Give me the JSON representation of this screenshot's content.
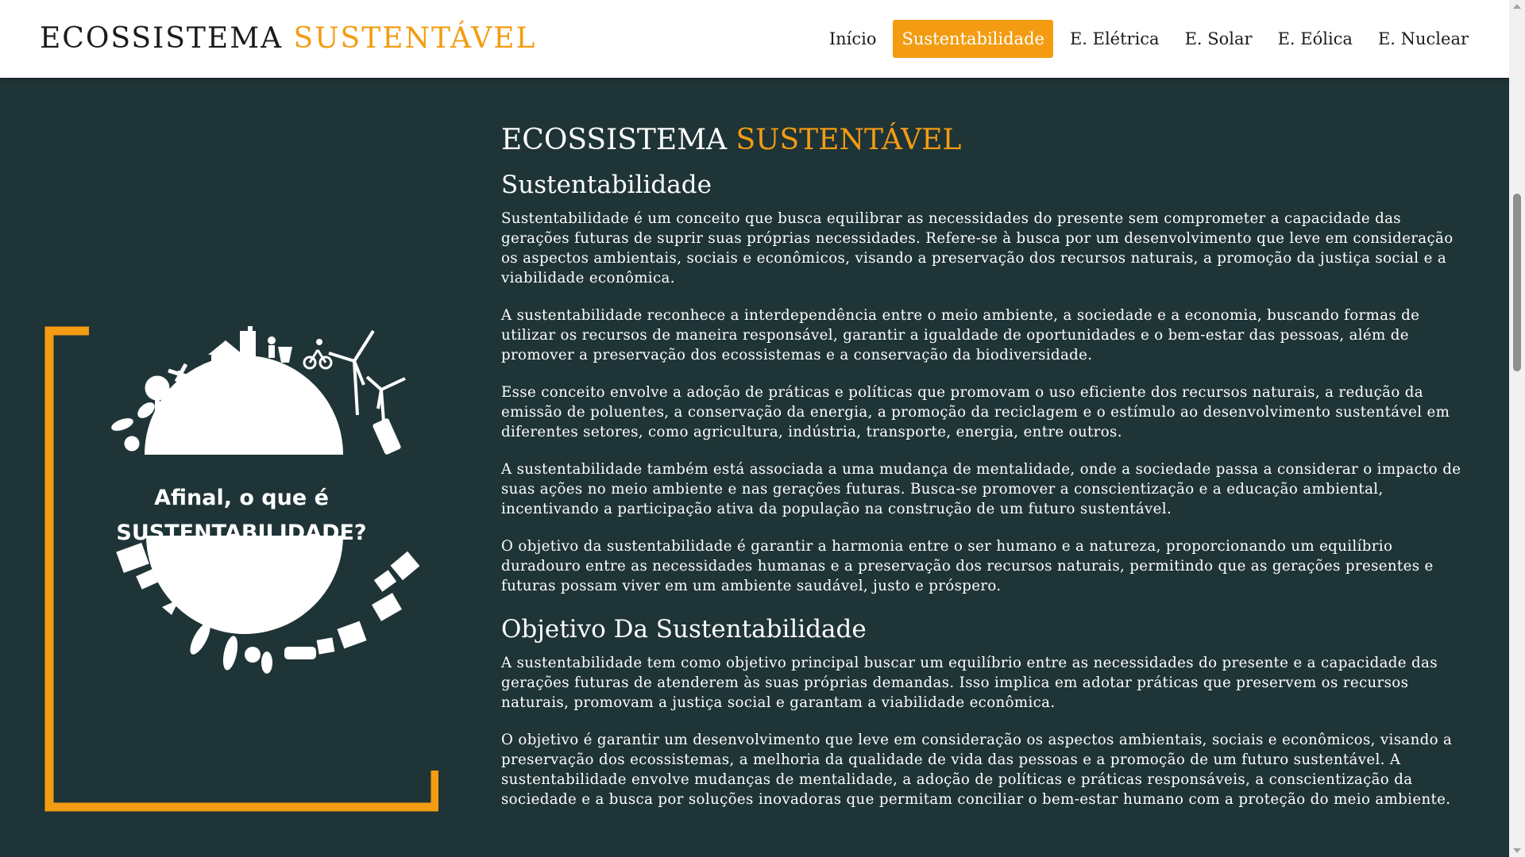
{
  "header": {
    "logo_main": "ECOSSISTEMA",
    "logo_accent": "SUSTENTÁVEL"
  },
  "nav": {
    "items": [
      {
        "label": "Início",
        "active": false
      },
      {
        "label": "Sustentabilidade",
        "active": true
      },
      {
        "label": "E. Elétrica",
        "active": false
      },
      {
        "label": "E. Solar",
        "active": false
      },
      {
        "label": "E. Eólica",
        "active": false
      },
      {
        "label": "E. Nuclear",
        "active": false
      }
    ]
  },
  "hero": {
    "caption_line1": "Afinal, o que é",
    "caption_line2": "SUSTENTABILIDADE?"
  },
  "content": {
    "title_main": "ECOSSISTEMA",
    "title_accent": "SUSTENTÁVEL",
    "section1": {
      "heading": "Sustentabilidade",
      "paragraphs": [
        "Sustentabilidade é um conceito que busca equilibrar as necessidades do presente sem comprometer a capacidade das gerações futuras de suprir suas próprias necessidades. Refere-se à busca por um desenvolvimento que leve em consideração os aspectos ambientais, sociais e econômicos, visando a preservação dos recursos naturais, a promoção da justiça social e a viabilidade econômica.",
        "A sustentabilidade reconhece a interdependência entre o meio ambiente, a sociedade e a economia, buscando formas de utilizar os recursos de maneira responsável, garantir a igualdade de oportunidades e o bem-estar das pessoas, além de promover a preservação dos ecossistemas e a conservação da biodiversidade.",
        "Esse conceito envolve a adoção de práticas e políticas que promovam o uso eficiente dos recursos naturais, a redução da emissão de poluentes, a conservação da energia, a promoção da reciclagem e o estímulo ao desenvolvimento sustentável em diferentes setores, como agricultura, indústria, transporte, energia, entre outros.",
        "A sustentabilidade também está associada a uma mudança de mentalidade, onde a sociedade passa a considerar o impacto de suas ações no meio ambiente e nas gerações futuras. Busca-se promover a conscientização e a educação ambiental, incentivando a participação ativa da população na construção de um futuro sustentável.",
        "O objetivo da sustentabilidade é garantir a harmonia entre o ser humano e a natureza, proporcionando um equilíbrio duradouro entre as necessidades humanas e a preservação dos recursos naturais, permitindo que as gerações presentes e futuras possam viver em um ambiente saudável, justo e próspero."
      ]
    },
    "section2": {
      "heading": "Objetivo Da Sustentabilidade",
      "paragraphs": [
        "A sustentabilidade tem como objetivo principal buscar um equilíbrio entre as necessidades do presente e a capacidade das gerações futuras de atenderem às suas próprias demandas. Isso implica em adotar práticas que preservem os recursos naturais, promovam a justiça social e garantam a viabilidade econômica.",
        "O objetivo é garantir um desenvolvimento que leve em consideração os aspectos ambientais, sociais e econômicos, visando a preservação dos ecossistemas, a melhoria da qualidade de vida das pessoas e a promoção de um futuro sustentável. A sustentabilidade envolve mudanças de mentalidade, a adoção de políticas e práticas responsáveis, a conscientização da sociedade e a busca por soluções inovadoras que permitam conciliar o bem-estar humano com a proteção do meio ambiente."
      ]
    }
  },
  "colors": {
    "accent": "#f39c12",
    "background": "#1f3436",
    "header_bg": "#ffffff",
    "text_light": "#ffffff",
    "text_dark": "#1b1b1b"
  }
}
